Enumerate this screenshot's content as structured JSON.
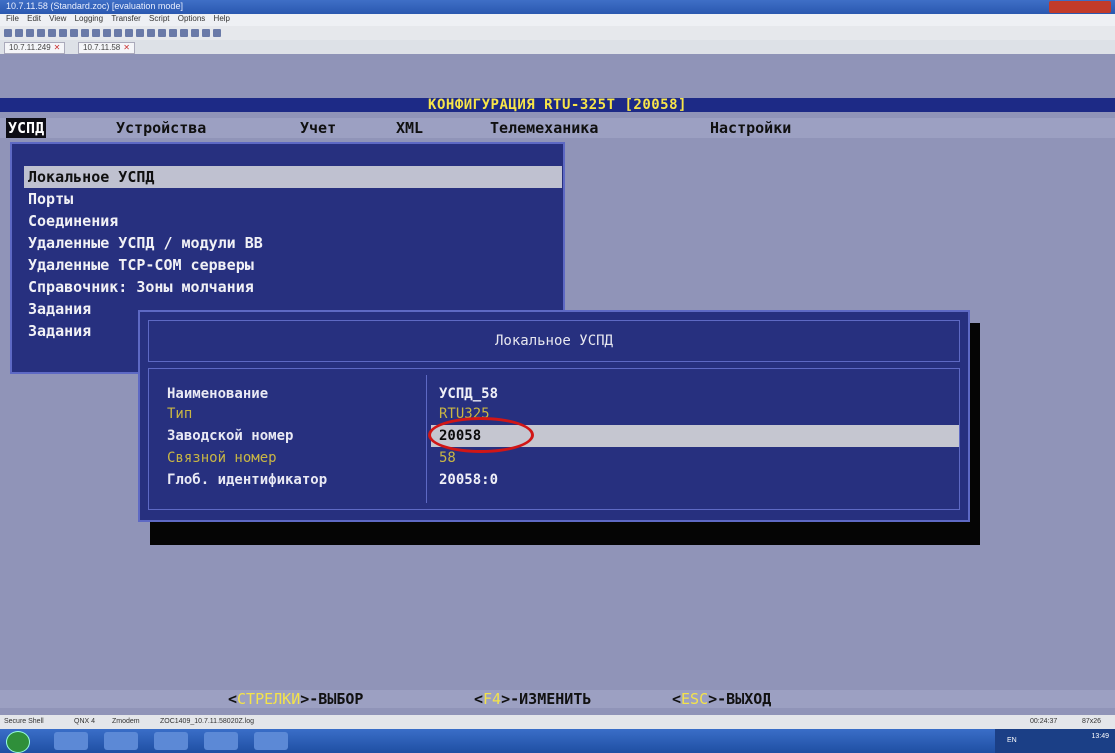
{
  "window": {
    "title": "10.7.11.58 (Standard.zoc) [evaluation mode]"
  },
  "menubar": [
    "File",
    "Edit",
    "View",
    "Logging",
    "Transfer",
    "Script",
    "Options",
    "Help"
  ],
  "tabs": [
    {
      "label": "10.7.11.249"
    },
    {
      "label": "10.7.11.58"
    }
  ],
  "terminal": {
    "config_title": "КОНФИГУРАЦИЯ RTU-325T [20058]",
    "main_menu": [
      "УСПД",
      "Устройства",
      "Учет",
      "XML",
      "Телемеханика",
      "Настройки"
    ],
    "submenu": [
      "Локальное УСПД",
      "Порты",
      "Соединения",
      "Удаленные УСПД / модули ВВ",
      "Удаленные TCP-COM серверы",
      "Справочник: Зоны молчания",
      "Задания",
      "Задания"
    ],
    "dialog": {
      "title": "Локальное УСПД",
      "fields": [
        {
          "label": "Наименование",
          "value": "УСПД_58"
        },
        {
          "label": "Тип",
          "value": "RTU325"
        },
        {
          "label": "Заводской номер",
          "value": "20058"
        },
        {
          "label": "Связной номер",
          "value": "58"
        },
        {
          "label": "Глоб. идентификатор",
          "value": "20058:0"
        }
      ]
    },
    "bottom": {
      "k1": "СТРЕЛКИ",
      "t1": "-ВЫБОР",
      "k2": "F4",
      "t2": "-ИЗМЕНИТЬ",
      "k3": "ESC",
      "t3": "-ВЫХОД"
    }
  },
  "statusbar": {
    "protocol": "Secure Shell",
    "emulation": "QNX 4",
    "transfer": "Zmodem",
    "logfile": "ZOC1409_10.7.11.58020Z.log",
    "time": "00:24:37",
    "size": "87x26"
  },
  "taskbar": {
    "clock": "13:49",
    "lang": "EN"
  },
  "colors": {
    "terminal_bg": "#9094b8",
    "panel": "#27307f",
    "highlight_yellow": "#f4e34a",
    "annotation_red": "#d11616"
  }
}
